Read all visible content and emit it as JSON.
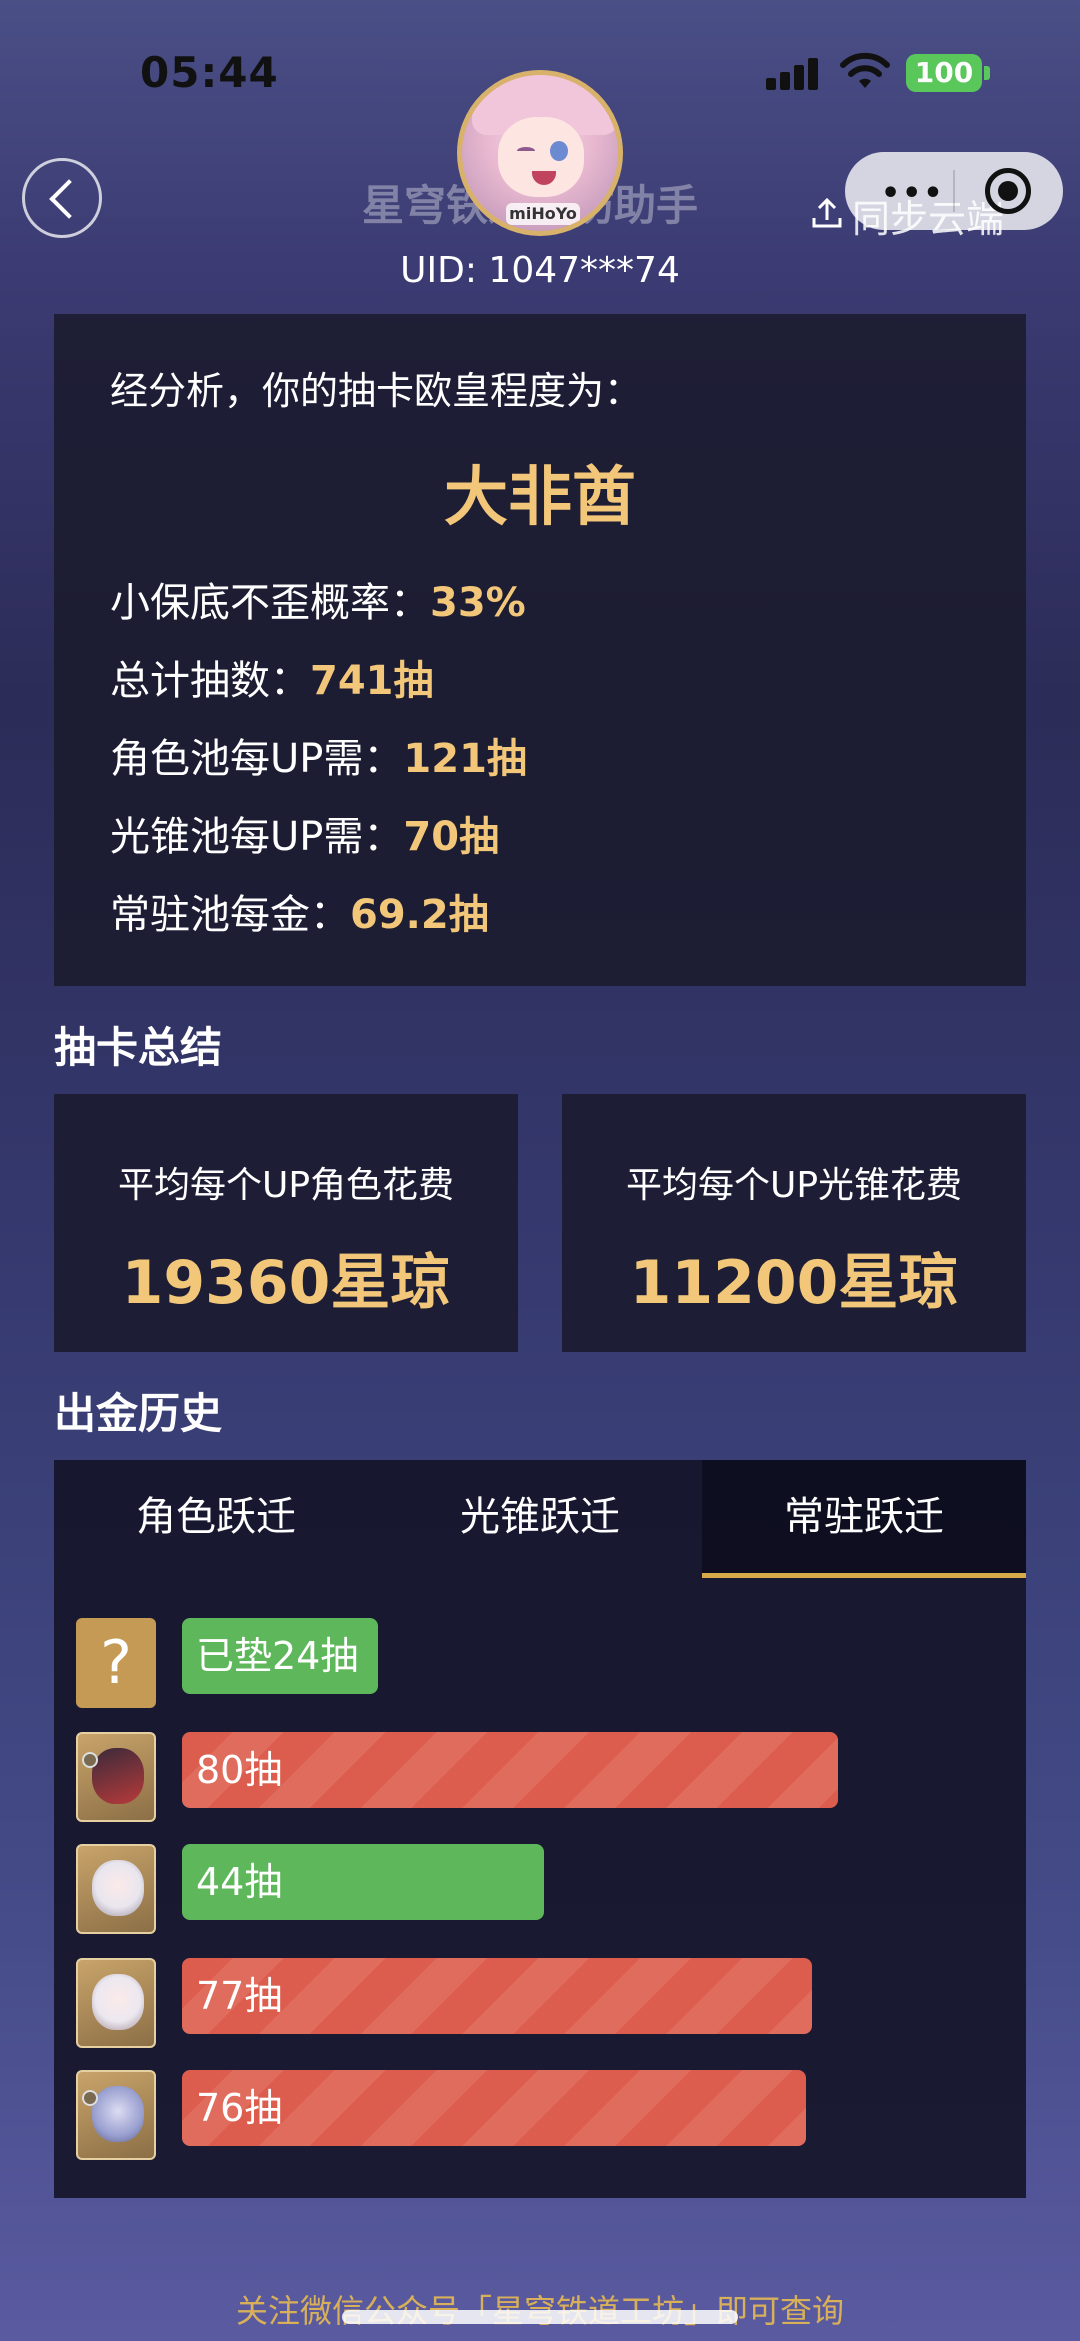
{
  "status_bar": {
    "time": "05:44",
    "battery": "100"
  },
  "nav": {
    "title": "星穹铁道工坊助手",
    "avatar_logo": "miHoYo",
    "sync_label": "同步云端",
    "uid": "UID: 1047***74"
  },
  "analysis": {
    "intro": "经分析，你的抽卡欧皇程度为：",
    "rating": "大非酋",
    "stats": [
      {
        "label": "小保底不歪概率：",
        "value": "33%"
      },
      {
        "label": "总计抽数：",
        "value": "741抽"
      },
      {
        "label": "角色池每UP需：",
        "value": "121抽"
      },
      {
        "label": "光锥池每UP需：",
        "value": "70抽"
      },
      {
        "label": "常驻池每金：",
        "value": "69.2抽"
      }
    ]
  },
  "summary": {
    "title": "抽卡总结",
    "character_label": "平均每个UP角色花费",
    "character_value": "19360星琼",
    "lightcone_label": "平均每个UP光锥花费",
    "lightcone_value": "11200星琼"
  },
  "history": {
    "title": "出金历史",
    "tabs": [
      "角色跃迁",
      "光锥跃迁",
      "常驻跃迁"
    ],
    "active_tab": 2,
    "rows": [
      {
        "icon": "question-mark-icon",
        "label": "已垫24抽",
        "pulls": 24,
        "status": "pending",
        "color": "#5fb75b"
      },
      {
        "icon": "character-portrait-icon",
        "label": "80抽",
        "pulls": 80,
        "status": "high",
        "color": "#dc5d4d"
      },
      {
        "icon": "character-portrait-icon",
        "label": "44抽",
        "pulls": 44,
        "status": "low",
        "color": "#5fb75b"
      },
      {
        "icon": "character-portrait-icon",
        "label": "77抽",
        "pulls": 77,
        "status": "high",
        "color": "#dc5d4d"
      },
      {
        "icon": "character-portrait-icon",
        "label": "76抽",
        "pulls": 76,
        "status": "high",
        "color": "#dc5d4d"
      }
    ]
  },
  "footer": {
    "text": "关注微信公众号「星穹铁道工坊」即可查询"
  },
  "colors": {
    "accent_gold": "#f2c77a",
    "bar_red": "#dc5d4d",
    "bar_green": "#5fb75b",
    "tab_underline": "#d6a949"
  }
}
